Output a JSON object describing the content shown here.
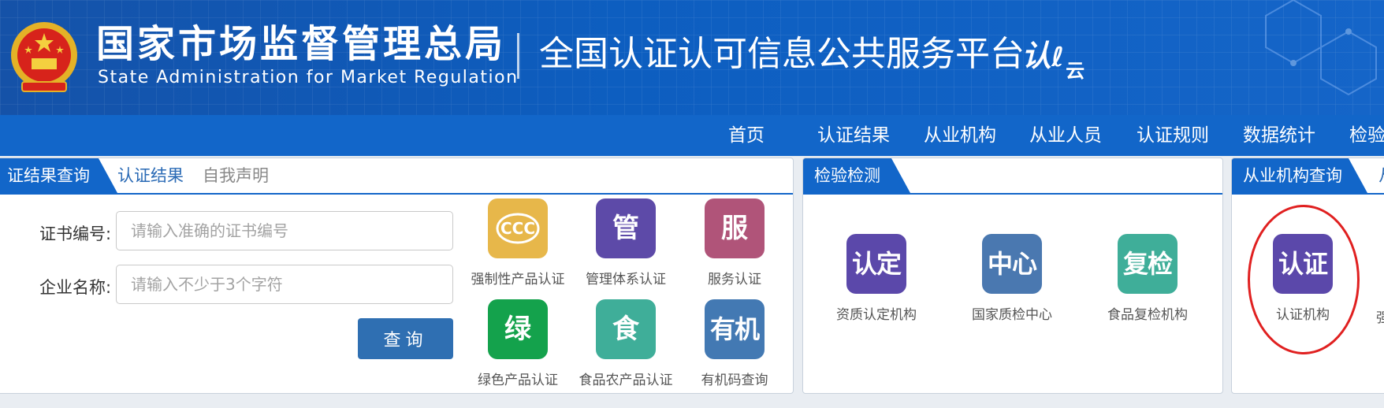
{
  "header": {
    "agency_cn": "国家市场监督管理总局",
    "agency_en": "State Administration  for  Market Regulation",
    "platform_title": "全国认证认可信息公共服务平台",
    "logo_text": "认",
    "logo_suffix": "云"
  },
  "nav": {
    "items": [
      {
        "label": "首页"
      },
      {
        "label": "认证结果"
      },
      {
        "label": "从业机构"
      },
      {
        "label": "从业人员"
      },
      {
        "label": "认证规则"
      },
      {
        "label": "数据统计"
      },
      {
        "label": "检验"
      }
    ]
  },
  "cert_panel": {
    "tab_active": "证结果查询",
    "tabs": [
      "认证结果",
      "自我声明"
    ],
    "fields": [
      {
        "label": "证书编号:",
        "placeholder": "请输入准确的证书编号"
      },
      {
        "label": "企业名称:",
        "placeholder": "请输入不少于3个字符"
      }
    ],
    "query_button": "查询",
    "tiles": [
      {
        "icon_text": "",
        "icon": "ccc-mark-icon",
        "caption": "强制性产品认证",
        "color": "#e7b74a"
      },
      {
        "icon_text": "管",
        "caption": "管理体系认证",
        "color": "#5d4aa8"
      },
      {
        "icon_text": "服",
        "caption": "服务认证",
        "color": "#b05479"
      },
      {
        "icon_text": "绿",
        "caption": "绿色产品认证",
        "color": "#14a24c"
      },
      {
        "icon_text": "食",
        "caption": "食品农产品认证",
        "color": "#3fae99"
      },
      {
        "icon_text": "有机",
        "caption": "有机码查询",
        "color": "#4379b3"
      }
    ]
  },
  "inspect_panel": {
    "tab_active": "检验检测",
    "tiles": [
      {
        "icon_text": "认定",
        "caption": "资质认定机构",
        "color": "#5b48aa"
      },
      {
        "icon_text": "中心",
        "caption": "国家质检中心",
        "color": "#4a78b0"
      },
      {
        "icon_text": "复检",
        "caption": "食品复检机构",
        "color": "#3fae99"
      }
    ]
  },
  "org_panel": {
    "tab_active": "从业机构查询",
    "tab_partial": "从",
    "tiles": [
      {
        "icon_text": "认证",
        "caption": "认证机构",
        "color": "#5b48aa"
      }
    ],
    "partial_caption": "强"
  },
  "colors": {
    "primary": "#1266c9",
    "highlight": "#e02020"
  }
}
